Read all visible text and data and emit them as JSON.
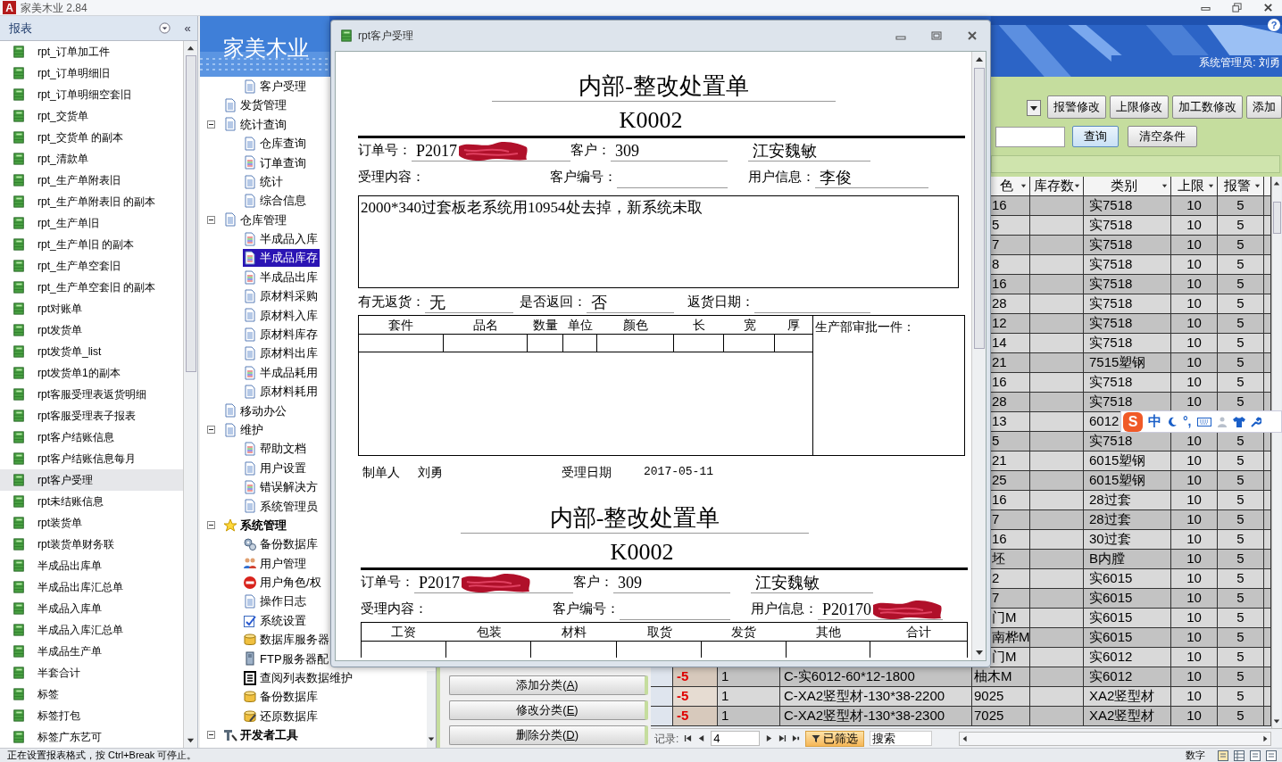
{
  "app": {
    "logo": "A",
    "title": "家美木业 2.84"
  },
  "nav": {
    "header": "报表",
    "collapse": "«",
    "items": [
      {
        "label": "rpt_订单加工件",
        "selected": false
      },
      {
        "label": "rpt_订单明细旧",
        "selected": false
      },
      {
        "label": "rpt_订单明细空套旧",
        "selected": false
      },
      {
        "label": "rpt_交货单",
        "selected": false
      },
      {
        "label": "rpt_交货单 的副本",
        "selected": false
      },
      {
        "label": "rpt_清款单",
        "selected": false
      },
      {
        "label": "rpt_生产单附表旧",
        "selected": false
      },
      {
        "label": "rpt_生产单附表旧 的副本",
        "selected": false
      },
      {
        "label": "rpt_生产单旧",
        "selected": false
      },
      {
        "label": "rpt_生产单旧 的副本",
        "selected": false
      },
      {
        "label": "rpt_生产单空套旧",
        "selected": false
      },
      {
        "label": "rpt_生产单空套旧 的副本",
        "selected": false
      },
      {
        "label": "rpt对账单",
        "selected": false
      },
      {
        "label": "rpt发货单",
        "selected": false
      },
      {
        "label": "rpt发货单_list",
        "selected": false
      },
      {
        "label": "rpt发货单1的副本",
        "selected": false
      },
      {
        "label": "rpt客服受理表返货明细",
        "selected": false
      },
      {
        "label": "rpt客服受理表子报表",
        "selected": false
      },
      {
        "label": "rpt客户结账信息",
        "selected": false
      },
      {
        "label": "rpt客户结账信息每月",
        "selected": false
      },
      {
        "label": "rpt客户受理",
        "selected": true
      },
      {
        "label": "rpt未结账信息",
        "selected": false
      },
      {
        "label": "rpt装货单",
        "selected": false
      },
      {
        "label": "rpt装货单财务联",
        "selected": false
      },
      {
        "label": "半成品出库单",
        "selected": false
      },
      {
        "label": "半成品出库汇总单",
        "selected": false
      },
      {
        "label": "半成品入库单",
        "selected": false
      },
      {
        "label": "半成品入库汇总单",
        "selected": false
      },
      {
        "label": "半成品生产单",
        "selected": false
      },
      {
        "label": "半套合计",
        "selected": false
      },
      {
        "label": "标签",
        "selected": false
      },
      {
        "label": "标签打包",
        "selected": false
      },
      {
        "label": "标签广东艺可",
        "selected": false
      }
    ]
  },
  "banner": {
    "logo": "家美木业",
    "user": "系统管理员: 刘勇",
    "help": "?"
  },
  "tree": [
    {
      "children": [
        {
          "label": "客户受理",
          "kind": "page",
          "selected": false
        }
      ]
    },
    {
      "label": "发货管理",
      "kind": "page",
      "selected": false
    },
    {
      "label": "统计查询",
      "kind": "page",
      "selected": false,
      "expanded": true,
      "children": [
        {
          "label": "仓库查询",
          "kind": "page",
          "selected": false
        },
        {
          "label": "订单查询",
          "kind": "list_page",
          "selected": false
        },
        {
          "label": "统计",
          "kind": "page",
          "selected": false
        },
        {
          "label": "综合信息",
          "kind": "page",
          "selected": false
        }
      ]
    },
    {
      "label": "仓库管理",
      "kind": "page",
      "selected": false,
      "expanded": true,
      "children": [
        {
          "label": "半成品入库",
          "kind": "list_page",
          "selected": false
        },
        {
          "label": "半成品库存",
          "kind": "list_page",
          "selected": true
        },
        {
          "label": "半成品出库",
          "kind": "list_page",
          "selected": false
        },
        {
          "label": "原材料采购",
          "kind": "page",
          "selected": false
        },
        {
          "label": "原材料入库",
          "kind": "page",
          "selected": false
        },
        {
          "label": "原材料库存",
          "kind": "page",
          "selected": false
        },
        {
          "label": "原材料出库",
          "kind": "page",
          "selected": false
        },
        {
          "label": "半成品耗用",
          "kind": "list_page",
          "selected": false
        },
        {
          "label": "原材料耗用",
          "kind": "page",
          "selected": false
        }
      ]
    },
    {
      "label": "移动办公",
      "kind": "page",
      "selected": false
    },
    {
      "label": "维护",
      "kind": "page",
      "selected": false,
      "expanded": true,
      "children": [
        {
          "label": "帮助文档",
          "kind": "list_page",
          "selected": false
        },
        {
          "label": "用户设置",
          "kind": "page",
          "selected": false
        },
        {
          "label": "错误解决方",
          "kind": "list_page",
          "selected": false
        },
        {
          "label": "系统管理员",
          "kind": "page",
          "selected": false
        }
      ]
    },
    {
      "label": "系统管理",
      "kind": "star",
      "selected": false,
      "expanded": true,
      "children": [
        {
          "label": "备份数据库",
          "kind": "gears",
          "selected": false
        },
        {
          "label": "用户管理",
          "kind": "users",
          "selected": false
        },
        {
          "label": "用户角色/权",
          "kind": "stop",
          "selected": false
        },
        {
          "label": "操作日志",
          "kind": "page",
          "selected": false
        },
        {
          "label": "系统设置",
          "kind": "settings",
          "selected": false
        },
        {
          "label": "数据库服务器",
          "kind": "database",
          "selected": false
        },
        {
          "label": "FTP服务器配",
          "kind": "server",
          "selected": false
        },
        {
          "label": "查阅列表数据维护",
          "kind": "list",
          "selected": false
        },
        {
          "label": "备份数据库",
          "kind": "database",
          "selected": false
        },
        {
          "label": "还原数据库",
          "kind": "database_edit",
          "selected": false
        }
      ]
    },
    {
      "label": "开发者工具",
      "kind": "tools",
      "selected": false,
      "expanded": true
    }
  ],
  "toolbar": {
    "buttons": [
      "报警修改",
      "上限修改",
      "加工数修改",
      "添加"
    ]
  },
  "search": {
    "buttons": [
      "查询",
      "清空条件"
    ]
  },
  "category_buttons": [
    "添加分类(A)",
    "修改分类(E)",
    "删除分类(D)"
  ],
  "grid": {
    "columns": [
      "色",
      "库存数",
      "类别",
      "上限",
      "报警"
    ],
    "rows": [
      {
        "kind": "covered",
        "column_1": "16",
        "category": "实7518",
        "limit": "10",
        "alarm": "5"
      },
      {
        "kind": "covered",
        "column_1": "5",
        "category": "实7518",
        "limit": "10",
        "alarm": "5"
      },
      {
        "kind": "covered",
        "column_1": "7",
        "category": "实7518",
        "limit": "10",
        "alarm": "5"
      },
      {
        "kind": "covered",
        "column_1": "8",
        "category": "实7518",
        "limit": "10",
        "alarm": "5"
      },
      {
        "kind": "covered",
        "column_1": "16",
        "category": "实7518",
        "limit": "10",
        "alarm": "5"
      },
      {
        "kind": "covered",
        "column_1": "28",
        "category": "实7518",
        "limit": "10",
        "alarm": "5"
      },
      {
        "kind": "covered",
        "column_1": "12",
        "category": "实7518",
        "limit": "10",
        "alarm": "5"
      },
      {
        "kind": "covered",
        "column_1": "14",
        "category": "实7518",
        "limit": "10",
        "alarm": "5"
      },
      {
        "kind": "covered",
        "column_1": "21",
        "category": "7515塑钢",
        "limit": "10",
        "alarm": "5"
      },
      {
        "kind": "covered",
        "column_1": "16",
        "category": "实7518",
        "limit": "10",
        "alarm": "5"
      },
      {
        "kind": "covered",
        "column_1": "28",
        "category": "实7518",
        "limit": "10",
        "alarm": "5"
      },
      {
        "kind": "covered",
        "column_1": "13",
        "category": "6012"
      },
      {
        "kind": "covered",
        "column_1": "5",
        "category": "实7518",
        "limit": "10",
        "alarm": "5"
      },
      {
        "kind": "covered",
        "column_1": "21",
        "category": "6015塑钢",
        "limit": "10",
        "alarm": "5"
      },
      {
        "kind": "covered",
        "column_1": "25",
        "category": "6015塑钢",
        "limit": "10",
        "alarm": "5"
      },
      {
        "kind": "covered",
        "column_1": "16",
        "category": "28过套",
        "limit": "10",
        "alarm": "5"
      },
      {
        "kind": "covered",
        "column_1": "7",
        "category": "28过套",
        "limit": "10",
        "alarm": "5"
      },
      {
        "kind": "covered",
        "column_1": "16",
        "category": "30过套",
        "limit": "10",
        "alarm": "5"
      },
      {
        "kind": "covered",
        "column_1": "坯",
        "category": "B内膛",
        "limit": "10",
        "alarm": "5"
      },
      {
        "kind": "covered",
        "column_1": "2",
        "category": "实6015",
        "limit": "10",
        "alarm": "5"
      },
      {
        "kind": "covered",
        "column_1": "7",
        "category": "实6015",
        "limit": "10",
        "alarm": "5"
      },
      {
        "kind": "covered",
        "column_1": "门M",
        "category": "实6015",
        "limit": "10",
        "alarm": "5"
      },
      {
        "kind": "covered",
        "column_1": "南桦M",
        "category": "实6015",
        "limit": "10",
        "alarm": "5"
      },
      {
        "kind": "covered",
        "column_1": "门M",
        "category": "实6012",
        "limit": "10",
        "alarm": "5"
      },
      {
        "kind": "full",
        "cell_1": "-5",
        "cell_2": "1",
        "cell_3": "C-实6012-60*12-1800",
        "column_1": "柚木M",
        "category": "实6012",
        "limit": "10",
        "alarm": "5"
      },
      {
        "kind": "full",
        "cell_1": "-5",
        "cell_2": "1",
        "cell_3": "C-XA2竖型材-130*38-2200",
        "column_1": "9025",
        "category": "XA2竖型材",
        "limit": "10",
        "alarm": "5"
      },
      {
        "kind": "full",
        "cell_1": "-5",
        "cell_2": "1",
        "cell_3": "C-XA2竖型材-130*38-2300",
        "column_1": "7025",
        "category": "XA2竖型材",
        "limit": "10",
        "alarm": "5"
      }
    ]
  },
  "record_nav": {
    "label": "记录:",
    "current": "4",
    "filter": "已筛选",
    "search": "搜索"
  },
  "report": {
    "title": "rpt客户受理",
    "sheets": [
      {
        "heading": "内部-整改处置单",
        "code": "K0002",
        "rows": [
          [
            {
              "label": "订单号：",
              "value": "P2017",
              "redacted": true,
              "line": true
            },
            {
              "label": "客户：",
              "value": "309",
              "redacted": false,
              "line": true
            },
            {
              "value": "江安魏敏",
              "redacted": false,
              "line": true
            }
          ],
          [
            {
              "label": "受理内容：",
              "line": false
            },
            {
              "label": "客户编号：",
              "line": true
            },
            {
              "label": "用户信息：",
              "value": "李俊",
              "redacted": false,
              "line": true
            }
          ]
        ],
        "content": "2000*340过套板老系统用10954处去掉，新系统未取",
        "return_fields": [
          {
            "label": "有无返货：",
            "value": "无",
            "line": true
          },
          {
            "label": "是否返回：",
            "value": "否",
            "line": true
          },
          {
            "label": "返货日期：",
            "line": true
          }
        ],
        "items_columns": [
          "套件",
          "品名",
          "数量",
          "单位",
          "颜色",
          "长",
          "宽",
          "厚"
        ],
        "approval_label": "生产部审批一件：",
        "footer": [
          {
            "label": "制单人",
            "value": "刘勇"
          },
          {
            "label": "受理日期",
            "value": "2017-05-11"
          }
        ]
      },
      {
        "heading": "内部-整改处置单",
        "code": "K0002",
        "rows": [
          [
            {
              "label": "订单号：",
              "value": "P2017",
              "redacted": true,
              "line": true
            },
            {
              "label": "客户：",
              "value": "309",
              "redacted": false,
              "line": true
            },
            {
              "value": "江安魏敏",
              "redacted": false,
              "line": true
            }
          ],
          [
            {
              "label": "受理内容：",
              "line": false
            },
            {
              "label": "客户编号：",
              "line": true
            },
            {
              "label": "用户信息：",
              "value": "P20170",
              "redacted": true,
              "line": true
            }
          ]
        ],
        "fee_columns": [
          "工资",
          "包装",
          "材料",
          "取货",
          "发货",
          "其他",
          "合计"
        ]
      }
    ]
  },
  "ime": {
    "logo": "S",
    "mode": "中",
    "punct": "°,"
  },
  "status_bar": {
    "message": "正在设置报表格式，按 Ctrl+Break 可停止。",
    "mode": "数字"
  }
}
